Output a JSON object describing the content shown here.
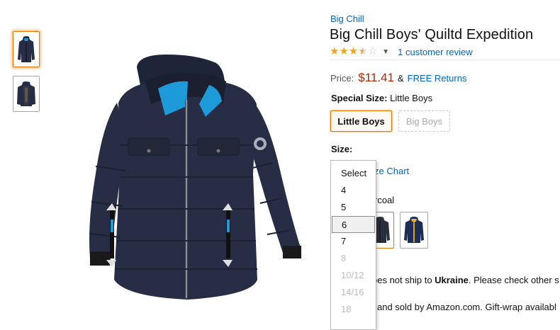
{
  "product": {
    "brand": "Big Chill",
    "title": "Big Chill Boys' Quiltd Expedition",
    "rating": {
      "stars": 3.5,
      "max": 5,
      "review_count_text": "1 customer review"
    },
    "price_label": "Price:",
    "price": "$11.41",
    "price_joiner": "&",
    "free_returns": "FREE Returns"
  },
  "special_size": {
    "label": "Special Size:",
    "value": "Little Boys",
    "options": [
      {
        "label": "Little Boys",
        "state": "selected"
      },
      {
        "label": "Big Boys",
        "state": "unavailable"
      }
    ]
  },
  "size": {
    "label": "Size:",
    "size_chart": "ze Chart",
    "dropdown": {
      "options": [
        {
          "label": "Select",
          "state": "enabled"
        },
        {
          "label": "4",
          "state": "enabled"
        },
        {
          "label": "5",
          "state": "enabled"
        },
        {
          "label": "6",
          "state": "highlighted"
        },
        {
          "label": "7",
          "state": "enabled"
        },
        {
          "label": "8",
          "state": "disabled"
        },
        {
          "label": "10/12",
          "state": "disabled"
        },
        {
          "label": "14/16",
          "state": "disabled"
        },
        {
          "label": "18",
          "state": "disabled"
        }
      ]
    }
  },
  "color": {
    "label": "rcoal",
    "swatches": [
      {
        "icon": "jacket-charcoal-swatch",
        "state": "selected"
      },
      {
        "icon": "jacket-navy-swatch",
        "state": "enabled"
      }
    ]
  },
  "shipping": {
    "prefix": "oes not ship to ",
    "country": "Ukraine",
    "suffix": ". Please check other s"
  },
  "sold_by": "and sold by Amazon.com. Gift-wrap availabl",
  "colors": {
    "link": "#0066c0",
    "price": "#b12704",
    "star": "#f4a41c",
    "selected_border": "#e77600",
    "jacket_primary": "#262d45",
    "jacket_accent": "#1d9ad8"
  }
}
